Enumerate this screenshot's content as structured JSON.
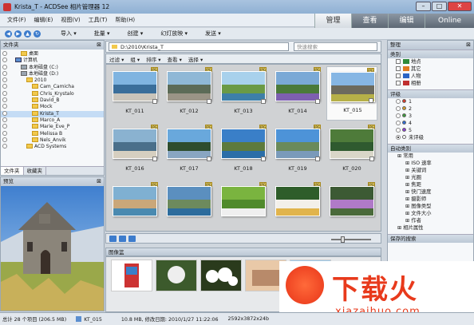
{
  "window": {
    "title": "Krista_T - ACDSee 相片管理器 12"
  },
  "menu": [
    "文件(F)",
    "编辑(E)",
    "视图(V)",
    "工具(T)",
    "帮助(H)"
  ],
  "modes": [
    {
      "label": "管理",
      "active": true
    },
    {
      "label": "查看",
      "active": false
    },
    {
      "label": "编辑",
      "active": false
    },
    {
      "label": "Online",
      "active": false
    }
  ],
  "toolbar": {
    "nav": [
      "◀",
      "▶",
      "▲",
      "↻"
    ],
    "items": [
      "导入 ▾",
      "批量 ▾",
      "创建 ▾",
      "幻灯放映 ▾",
      "发送 ▾"
    ]
  },
  "folders_panel": {
    "title": "文件夹",
    "tree": [
      {
        "label": "桌面",
        "icon": "folder",
        "indent": 2
      },
      {
        "label": "计算机",
        "icon": "computer",
        "indent": 1
      },
      {
        "label": "本地磁盘 (C:)",
        "icon": "drive",
        "indent": 2
      },
      {
        "label": "本地磁盘 (D:)",
        "icon": "drive",
        "indent": 2
      },
      {
        "label": "2010",
        "icon": "folder",
        "indent": 3
      },
      {
        "label": "Cam_Camicha",
        "icon": "folder",
        "indent": 4
      },
      {
        "label": "Chris_Krystalo",
        "icon": "folder",
        "indent": 4
      },
      {
        "label": "David_B",
        "icon": "folder",
        "indent": 4
      },
      {
        "label": "Mock",
        "icon": "folder",
        "indent": 4
      },
      {
        "label": "Krista_T",
        "icon": "folder",
        "indent": 4,
        "selected": true
      },
      {
        "label": "Marco_A",
        "icon": "folder",
        "indent": 4
      },
      {
        "label": "Marie_Eve_P",
        "icon": "folder",
        "indent": 4
      },
      {
        "label": "Melissa B",
        "icon": "folder",
        "indent": 4
      },
      {
        "label": "Nels_Anvik",
        "icon": "folder",
        "indent": 4
      },
      {
        "label": "ACD Systems",
        "icon": "folder",
        "indent": 3
      }
    ],
    "tabs": [
      "文件夹",
      "收藏夹"
    ]
  },
  "preview_panel": {
    "title": "预览"
  },
  "path": {
    "value": "D:\\2010\\Krista_T",
    "search_placeholder": "快速搜索"
  },
  "filters": [
    "过滤 ▾",
    "组 ▾",
    "排序 ▾",
    "查看 ▾",
    "选择 ▾"
  ],
  "thumbnails": [
    {
      "name": "KT_011",
      "colors": [
        "#7fb4e0",
        "#3a6e9a",
        "#c9c4ba"
      ]
    },
    {
      "name": "KT_012",
      "colors": [
        "#8fb8d6",
        "#5c6b57",
        "#9a9486"
      ]
    },
    {
      "name": "KT_013",
      "colors": [
        "#a8d1ec",
        "#6a9a45",
        "#3d7fa8"
      ]
    },
    {
      "name": "KT_014",
      "colors": [
        "#7aa9d6",
        "#4a7a3a",
        "#7d5fb0"
      ]
    },
    {
      "name": "KT_015",
      "colors": [
        "#86b6e4",
        "#6c6a5e",
        "#b6b048"
      ]
    },
    {
      "name": "KT_016",
      "colors": [
        "#8ab2d0",
        "#4a6f8a",
        "#d6cfc0"
      ]
    },
    {
      "name": "KT_017",
      "colors": [
        "#69a8dc",
        "#2e4d2e",
        "#89a6c2"
      ]
    },
    {
      "name": "KT_018",
      "colors": [
        "#3a7fc8",
        "#5d7a3c",
        "#2b6ea8"
      ]
    },
    {
      "name": "KT_019",
      "colors": [
        "#4d93d8",
        "#6a8a5a",
        "#7a9aba"
      ]
    },
    {
      "name": "KT_020",
      "colors": [
        "#4e7b3a",
        "#2f5a2f",
        "#d9d6c8"
      ]
    },
    {
      "name": "",
      "colors": [
        "#7fb0d2",
        "#caa779",
        "#4a8ab0"
      ]
    },
    {
      "name": "",
      "colors": [
        "#5b8fbf",
        "#6d8a5d",
        "#2d6c9c"
      ]
    },
    {
      "name": "",
      "colors": [
        "#7ab43f",
        "#4f8a2b",
        "#efefef"
      ]
    },
    {
      "name": "",
      "colors": [
        "#2e5d2a",
        "#f3f0ea",
        "#e1b44c"
      ]
    },
    {
      "name": "",
      "colors": [
        "#3c5a34",
        "#b07ac8",
        "#4a6a3a"
      ]
    }
  ],
  "filmstrip": {
    "title": "图像篮"
  },
  "organize_panel": {
    "title": "整理",
    "categories": {
      "title": "类别",
      "items": [
        {
          "label": "地点",
          "color": "#2f8a3a"
        },
        {
          "label": "其它",
          "color": "#e07a20"
        },
        {
          "label": "人物",
          "color": "#2b64c4"
        },
        {
          "label": "相册",
          "color": "#c03030"
        }
      ]
    },
    "ratings": {
      "title": "评级",
      "items": [
        {
          "label": "1",
          "color": "#d63a2a"
        },
        {
          "label": "2",
          "color": "#d6a02a"
        },
        {
          "label": "3",
          "color": "#3a9a3a"
        },
        {
          "label": "4",
          "color": "#2a6ad6"
        },
        {
          "label": "5",
          "color": "#8a3ad6"
        },
        {
          "label": "未评级",
          "color": "#ffffff",
          "checked": true
        }
      ]
    },
    "auto_cats": {
      "title": "自动类别",
      "items": [
        "常用",
        "ISO 速率",
        "关键词",
        "光圈",
        "焦距",
        "快门速度",
        "摄影师",
        "图像类型",
        "文件大小",
        "作者",
        "相片属性"
      ]
    },
    "saved": {
      "title": "保存的搜索"
    }
  },
  "status": {
    "total": "总计 28 个项目 (206.5 MB)",
    "file": "KT_015",
    "info": "10.8 MB, 修改日期: 2010/1/27 11:22:06",
    "dims": "2592x3872x24b"
  },
  "watermark": {
    "text": "下载火",
    "url": "xiazaihuo.com"
  }
}
